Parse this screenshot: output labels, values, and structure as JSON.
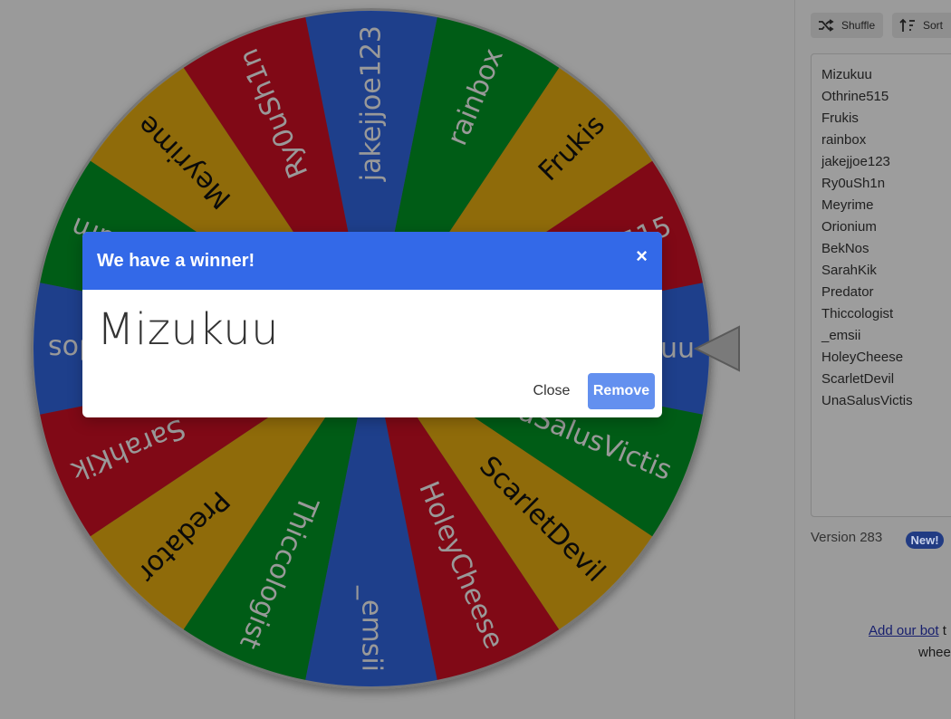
{
  "wheel": {
    "segments": [
      {
        "label": "Mizukuu",
        "color": "#3369e8"
      },
      {
        "label": "Othrine515",
        "color": "#d50f25"
      },
      {
        "label": "Frukis",
        "color": "#eeb211"
      },
      {
        "label": "rainbox",
        "color": "#009925"
      },
      {
        "label": "jakejjoe123",
        "color": "#3369e8"
      },
      {
        "label": "Ry0uSh1n",
        "color": "#d50f25"
      },
      {
        "label": "Meyrime",
        "color": "#eeb211"
      },
      {
        "label": "Orionium",
        "color": "#009925"
      },
      {
        "label": "BekNos",
        "color": "#3369e8"
      },
      {
        "label": "SarahKik",
        "color": "#d50f25"
      },
      {
        "label": "Predator",
        "color": "#eeb211"
      },
      {
        "label": "Thiccologist",
        "color": "#009925"
      },
      {
        "label": "_emsii",
        "color": "#3369e8"
      },
      {
        "label": "HoleyCheese",
        "color": "#d50f25"
      },
      {
        "label": "ScarletDevil",
        "color": "#eeb211"
      },
      {
        "label": "UnaSalusVictis",
        "color": "#009925"
      }
    ],
    "pointer_color": "#7a7a7a"
  },
  "toolbar": {
    "shuffle_label": "Shuffle",
    "sort_label": "Sort",
    "shuffle_icon": "shuffle-icon",
    "sort_icon": "sort-icon"
  },
  "entries": [
    "Mizukuu",
    "Othrine515",
    "Frukis",
    "rainbox",
    "jakejjoe123",
    "Ry0uSh1n",
    "Meyrime",
    "Orionium",
    "BekNos",
    "SarahKik",
    "Predator",
    "Thiccologist",
    "_emsii",
    "HoleyCheese",
    "ScarletDevil",
    "UnaSalusVictis"
  ],
  "footer": {
    "version": "Version 283",
    "new_badge": "New!",
    "bot_link": "Add our bot",
    "bot_text_tail": " t",
    "bot_line2": "whee"
  },
  "dialog": {
    "title": "We have a winner!",
    "close_x": "×",
    "winner": "Mizukuu",
    "close_button": "Close",
    "remove_button": "Remove"
  },
  "colors": {
    "header_blue": "#3369e8",
    "remove_button": "#6390ef",
    "overlay_dim": "rgba(0,0,0,0.4)"
  }
}
